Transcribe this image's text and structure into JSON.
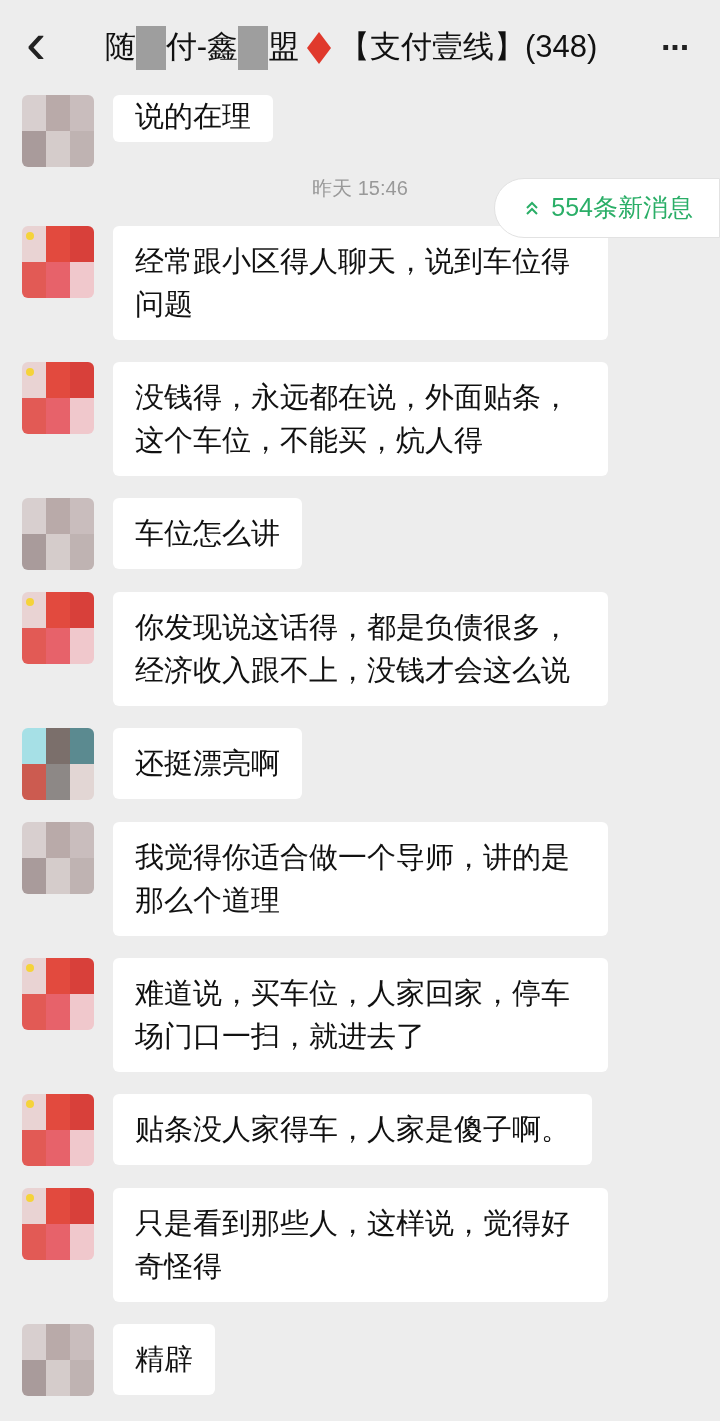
{
  "header": {
    "back_icon": "‹",
    "title_parts": [
      "随",
      "付-鑫",
      "盟"
    ],
    "title_suffix": "【支付壹线】(348)",
    "more": "···"
  },
  "top_message": {
    "text": "说的在理"
  },
  "timestamp": "昨天 15:46",
  "new_messages": {
    "label": "554条新消息"
  },
  "messages": [
    {
      "text": "经常跟小区得人聊天，说到车位得问题"
    },
    {
      "text": "没钱得，永远都在说，外面贴条，这个车位，不能买，炕人得"
    },
    {
      "text": "车位怎么讲"
    },
    {
      "text": "你发现说这话得，都是负债很多，经济收入跟不上，没钱才会这么说"
    },
    {
      "text": "还挺漂亮啊"
    },
    {
      "text": "我觉得你适合做一个导师，讲的是那么个道理"
    },
    {
      "text": "难道说，买车位，人家回家，停车场门口一扫，就进去了"
    },
    {
      "text": "贴条没人家得车，人家是傻子啊。"
    },
    {
      "text": "只是看到那些人，这样说，觉得好奇怪得"
    },
    {
      "text": "精辟"
    }
  ]
}
